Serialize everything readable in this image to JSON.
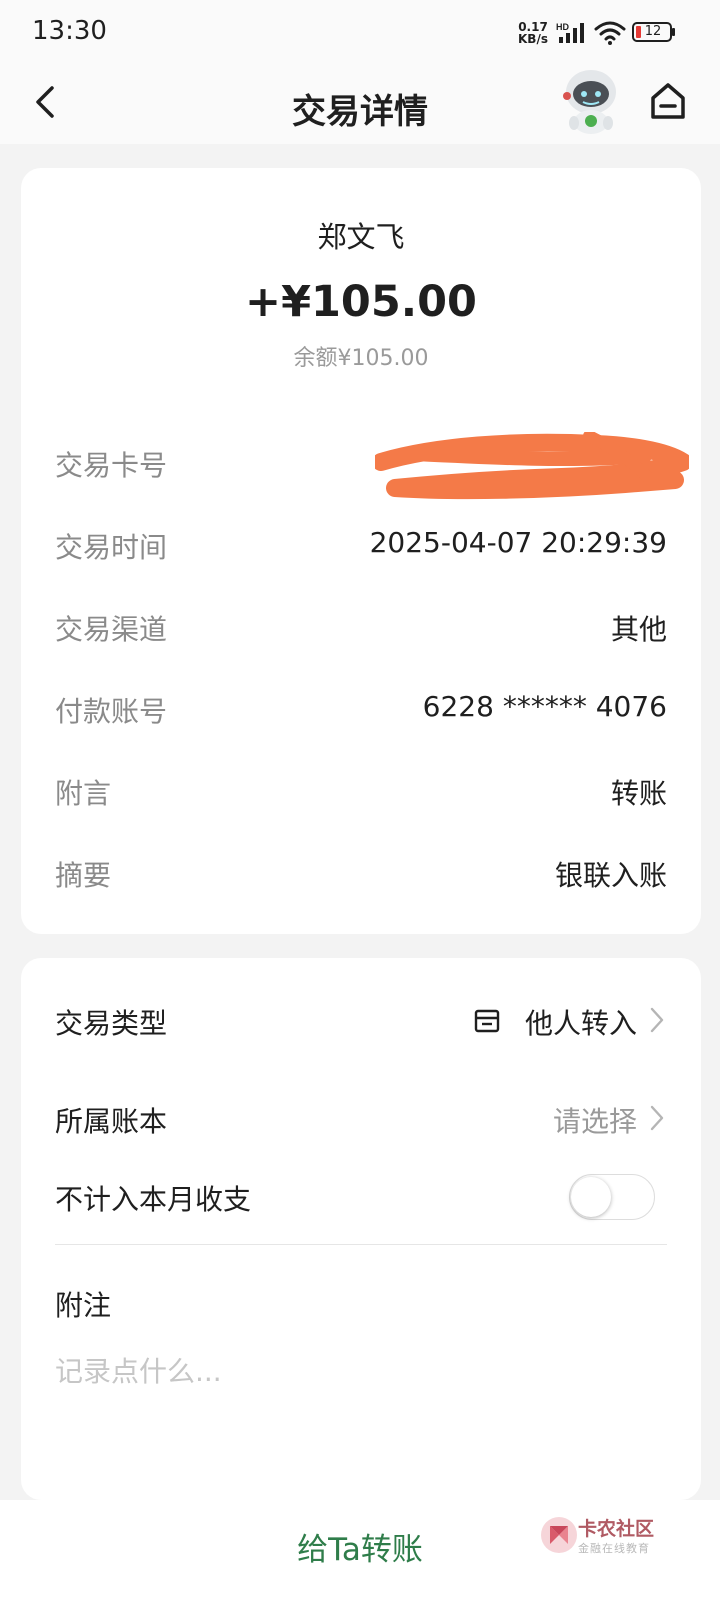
{
  "status_bar": {
    "time": "13:30",
    "net_speed_value": "0.17",
    "net_speed_unit": "KB/s",
    "signal_label": "HD",
    "battery_level": "12",
    "signal_icon": "signal-icon",
    "wifi_icon": "wifi-icon",
    "battery_icon": "battery-icon",
    "battery_color": "#e53935"
  },
  "header": {
    "title": "交易详情",
    "back_icon": "back-arrow-icon",
    "avatar": "robot-assistant-avatar",
    "home_icon": "home-icon"
  },
  "summary": {
    "payer_name": "郑文飞",
    "amount": "+¥105.00",
    "balance": "余额¥105.00",
    "details": [
      {
        "label": "交易卡号",
        "value": "",
        "redacted": true
      },
      {
        "label": "交易时间",
        "value": "2025-04-07 20:29:39"
      },
      {
        "label": "交易渠道",
        "value": "其他"
      },
      {
        "label": "付款账号",
        "value": "6228 ****** 4076"
      },
      {
        "label": "附言",
        "value": "转账"
      },
      {
        "label": "摘要",
        "value": "银联入账"
      }
    ],
    "redaction_color": "#f47a48"
  },
  "actions": {
    "transaction_type": {
      "label": "交易类型",
      "value": "他人转入",
      "icon": "transfer-type-icon"
    },
    "account_book": {
      "label": "所属账本",
      "value": "请选择"
    },
    "exclude_monthly": {
      "label": "不计入本月收支",
      "enabled": false
    },
    "note": {
      "label": "附注",
      "placeholder": "记录点什么..."
    }
  },
  "bottom": {
    "transfer_label": "给Ta转账",
    "accent_color": "#2f7d4a"
  },
  "watermark": {
    "title": "卡农社区",
    "subtitle": "金融在线教育"
  }
}
